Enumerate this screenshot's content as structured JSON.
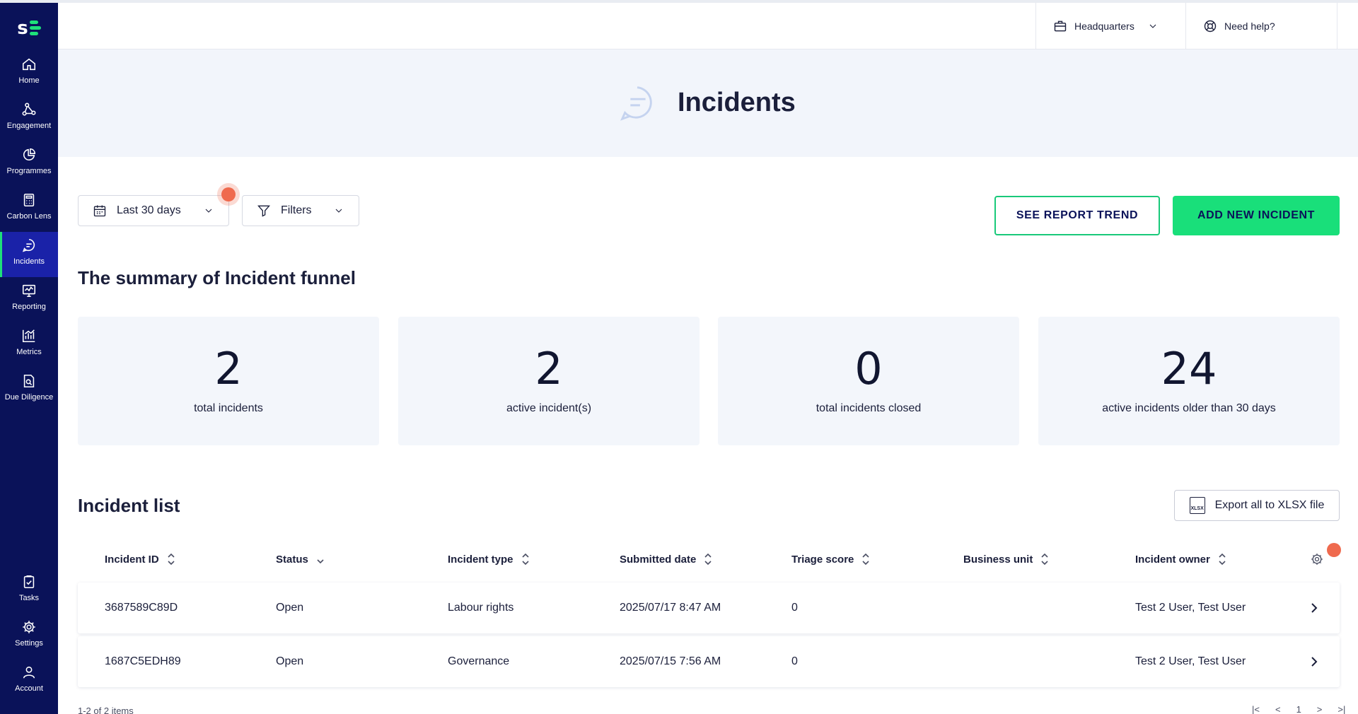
{
  "sidebar": {
    "logo_letter": "s",
    "items": [
      {
        "label": "Home",
        "icon": "home-icon"
      },
      {
        "label": "Engagement",
        "icon": "network-icon"
      },
      {
        "label": "Programmes",
        "icon": "pie-chart-icon"
      },
      {
        "label": "Carbon Lens",
        "icon": "calculator-icon"
      },
      {
        "label": "Incidents",
        "icon": "chat-icon",
        "active": true
      },
      {
        "label": "Reporting",
        "icon": "monitor-chart-icon"
      },
      {
        "label": "Metrics",
        "icon": "bar-chart-icon"
      },
      {
        "label": "Due Diligence",
        "icon": "document-search-icon"
      }
    ],
    "bottom_items": [
      {
        "label": "Tasks",
        "icon": "clipboard-check-icon"
      },
      {
        "label": "Settings",
        "icon": "gear-icon"
      },
      {
        "label": "Account",
        "icon": "user-icon"
      }
    ]
  },
  "topbar": {
    "org_label": "Headquarters",
    "help_label": "Need help?"
  },
  "header": {
    "title": "Incidents"
  },
  "controls": {
    "date_range": "Last 30 days",
    "filters": "Filters",
    "see_report_trend": "SEE REPORT TREND",
    "add_new_incident": "ADD NEW INCIDENT"
  },
  "summary": {
    "title": "The summary of Incident funnel",
    "cards": [
      {
        "value": "2",
        "caption": "total incidents"
      },
      {
        "value": "2",
        "caption": "active incident(s)"
      },
      {
        "value": "0",
        "caption": "total incidents closed"
      },
      {
        "value": "24",
        "caption": "active incidents older than 30 days"
      }
    ]
  },
  "list": {
    "title": "Incident list",
    "export_label": "Export all to XLSX file",
    "xlsx_badge": "XLSX",
    "columns": [
      "Incident ID",
      "Status",
      "Incident type",
      "Submitted date",
      "Triage score",
      "Business unit",
      "Incident owner"
    ],
    "rows": [
      {
        "id": "3687589C89D",
        "status": "Open",
        "type": "Labour rights",
        "date": "2025/07/17 8:47 AM",
        "triage": "0",
        "unit": "",
        "owner": "Test 2 User, Test User"
      },
      {
        "id": "1687C5EDH89",
        "status": "Open",
        "type": "Governance",
        "date": "2025/07/15 7:56 AM",
        "triage": "0",
        "unit": "",
        "owner": "Test 2 User, Test User"
      }
    ],
    "footer_count": "1-2 of 2 items",
    "page": "1"
  },
  "colors": {
    "sidebar_bg": "#0a1259",
    "accent_green": "#19df7a",
    "alert_dot": "#ef6a4e",
    "header_bg": "#f2f5fb"
  }
}
